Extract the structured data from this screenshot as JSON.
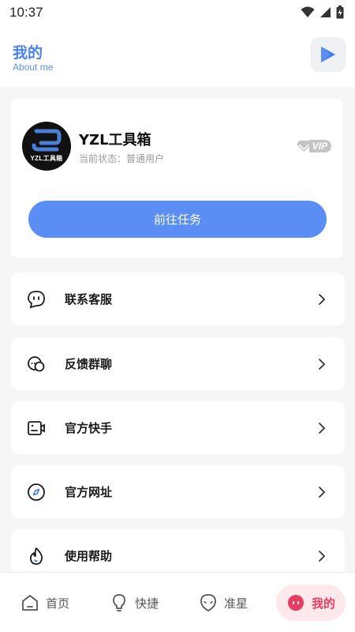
{
  "status_bar": {
    "time": "10:37",
    "icons": [
      "wifi-icon",
      "signal-icon",
      "battery-charging-icon"
    ]
  },
  "header": {
    "title": "我的",
    "subtitle": "About me",
    "action_icon": "play-icon",
    "accent_color": "#4a82f2"
  },
  "profile": {
    "avatar_text": "YZL工具箱",
    "username": "YZL工具箱",
    "status": "当前状态：普通用户",
    "badge": "VIP",
    "task_button": "前往任务",
    "button_color": "#5b8ef5"
  },
  "menu": {
    "items": [
      {
        "label": "联系客服",
        "icon": "chat-bubble-icon"
      },
      {
        "label": "反馈群聊",
        "icon": "group-chat-icon"
      },
      {
        "label": "官方快手",
        "icon": "video-camera-icon"
      },
      {
        "label": "官方网址",
        "icon": "compass-icon"
      },
      {
        "label": "使用帮助",
        "icon": "flame-icon"
      }
    ]
  },
  "bottom_nav": {
    "items": [
      {
        "label": "首页",
        "icon": "home-icon"
      },
      {
        "label": "快捷",
        "icon": "lightbulb-icon"
      },
      {
        "label": "准星",
        "icon": "alien-icon"
      },
      {
        "label": "我的",
        "icon": "profile-face-icon",
        "active": true
      }
    ],
    "active_color": "#e83b5f"
  }
}
